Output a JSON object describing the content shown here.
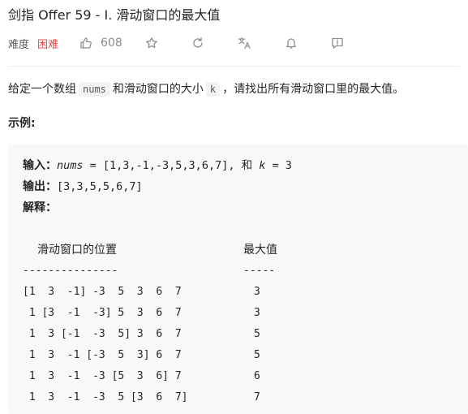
{
  "problem": {
    "title": "剑指 Offer 59 - I. 滑动窗口的最大值",
    "difficulty_label": "难度",
    "difficulty_value": "困难",
    "likes": "608",
    "colors": {
      "difficulty_hard": "#ef4743",
      "icon_gray": "#8c8c8c"
    },
    "icons": [
      "thumbs-up-icon",
      "star-icon",
      "refresh-icon",
      "translate-icon",
      "bell-icon",
      "feedback-icon"
    ]
  },
  "description": {
    "part1": "给定一个数组",
    "code1": "nums",
    "part2": "和滑动窗口的大小",
    "code2": "k",
    "part3": "，请找出所有滑动窗口里的最大值。"
  },
  "example": {
    "heading": "示例:",
    "input_label": "输入：",
    "input_var1": "nums",
    "input_part1": " = [1,3,-1,-3,5,3,6,7], 和 ",
    "input_var2": "k",
    "input_part2": " = 3",
    "output_label": "输出：",
    "output_value": "[3,3,5,5,6,7]",
    "explain_label": "解释：",
    "table": {
      "header_position": "滑动窗口的位置",
      "header_max": "最大值",
      "sep_position": "---------------",
      "sep_max": "-----",
      "rows": [
        {
          "window": "[1  3  -1] -3  5  3  6  7",
          "max": "3"
        },
        {
          "window": " 1 [3  -1  -3] 5  3  6  7",
          "max": "3"
        },
        {
          "window": " 1  3 [-1  -3  5] 3  6  7",
          "max": "5"
        },
        {
          "window": " 1  3  -1 [-3  5  3] 6  7",
          "max": "5"
        },
        {
          "window": " 1  3  -1  -3 [5  3  6] 7",
          "max": "6"
        },
        {
          "window": " 1  3  -1  -3  5 [3  6  7]",
          "max": "7"
        }
      ]
    }
  }
}
